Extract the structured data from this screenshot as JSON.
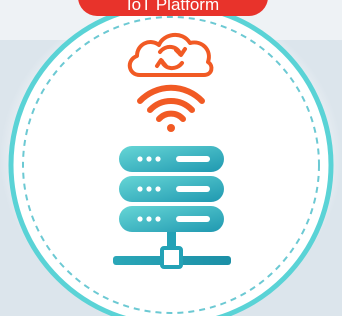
{
  "header": {
    "label": "IoT Platform"
  },
  "colors": {
    "accent": "#e8332b",
    "ring": "#5ad3d6",
    "ring_dashed": "#6cc9d3",
    "orange": "#f15a24",
    "server_top": "#5fd0d2",
    "server_bottom": "#1e9bb0",
    "background_haze": "#dfe7ee"
  },
  "icons": [
    "cloud-sync-icon",
    "wifi-icon",
    "server-stack-icon"
  ]
}
